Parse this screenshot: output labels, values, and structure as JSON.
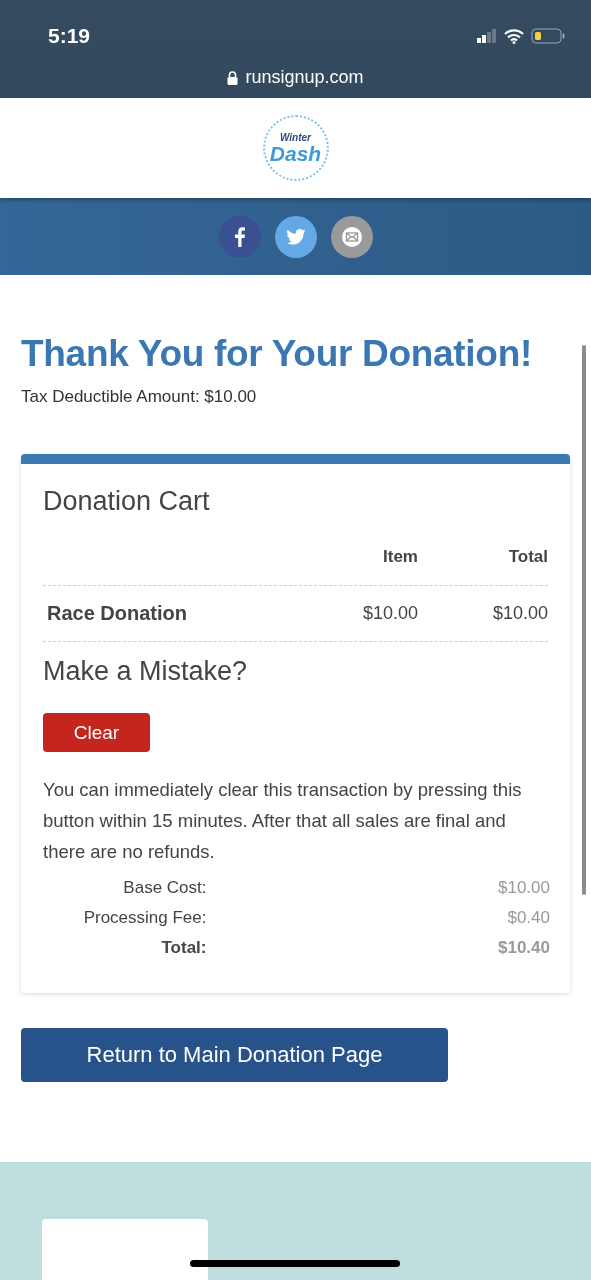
{
  "status_bar": {
    "time": "5:19"
  },
  "browser": {
    "url": "runsignup.com"
  },
  "logo": {
    "line_1": "Winter",
    "line_2": "Dash"
  },
  "share": [
    {
      "kind": "facebook"
    },
    {
      "kind": "twitter"
    },
    {
      "kind": "email"
    }
  ],
  "heading": "Thank You for Your Donation!",
  "tax_note": "Tax Deductible Amount: $10.00",
  "cart": {
    "title": "Donation Cart",
    "columns": [
      "Item",
      "Total"
    ],
    "rows": [
      {
        "name": "Race Donation",
        "item": "$10.00",
        "total": "$10.00"
      }
    ],
    "mistake_title": "Make a Mistake?",
    "clear_button": "Clear",
    "notice": "You can immediately clear this transaction by pressing this button within 15 minutes. After that all sales are final and there are no refunds.",
    "summary": [
      {
        "kind": "line",
        "label": "Base Cost:",
        "value": "$10.00"
      },
      {
        "kind": "line",
        "label": "Processing Fee:",
        "value": "$0.40"
      },
      {
        "kind": "total",
        "label": "Total:",
        "value": "$10.40"
      }
    ]
  },
  "return_button": "Return to Main Donation Page"
}
